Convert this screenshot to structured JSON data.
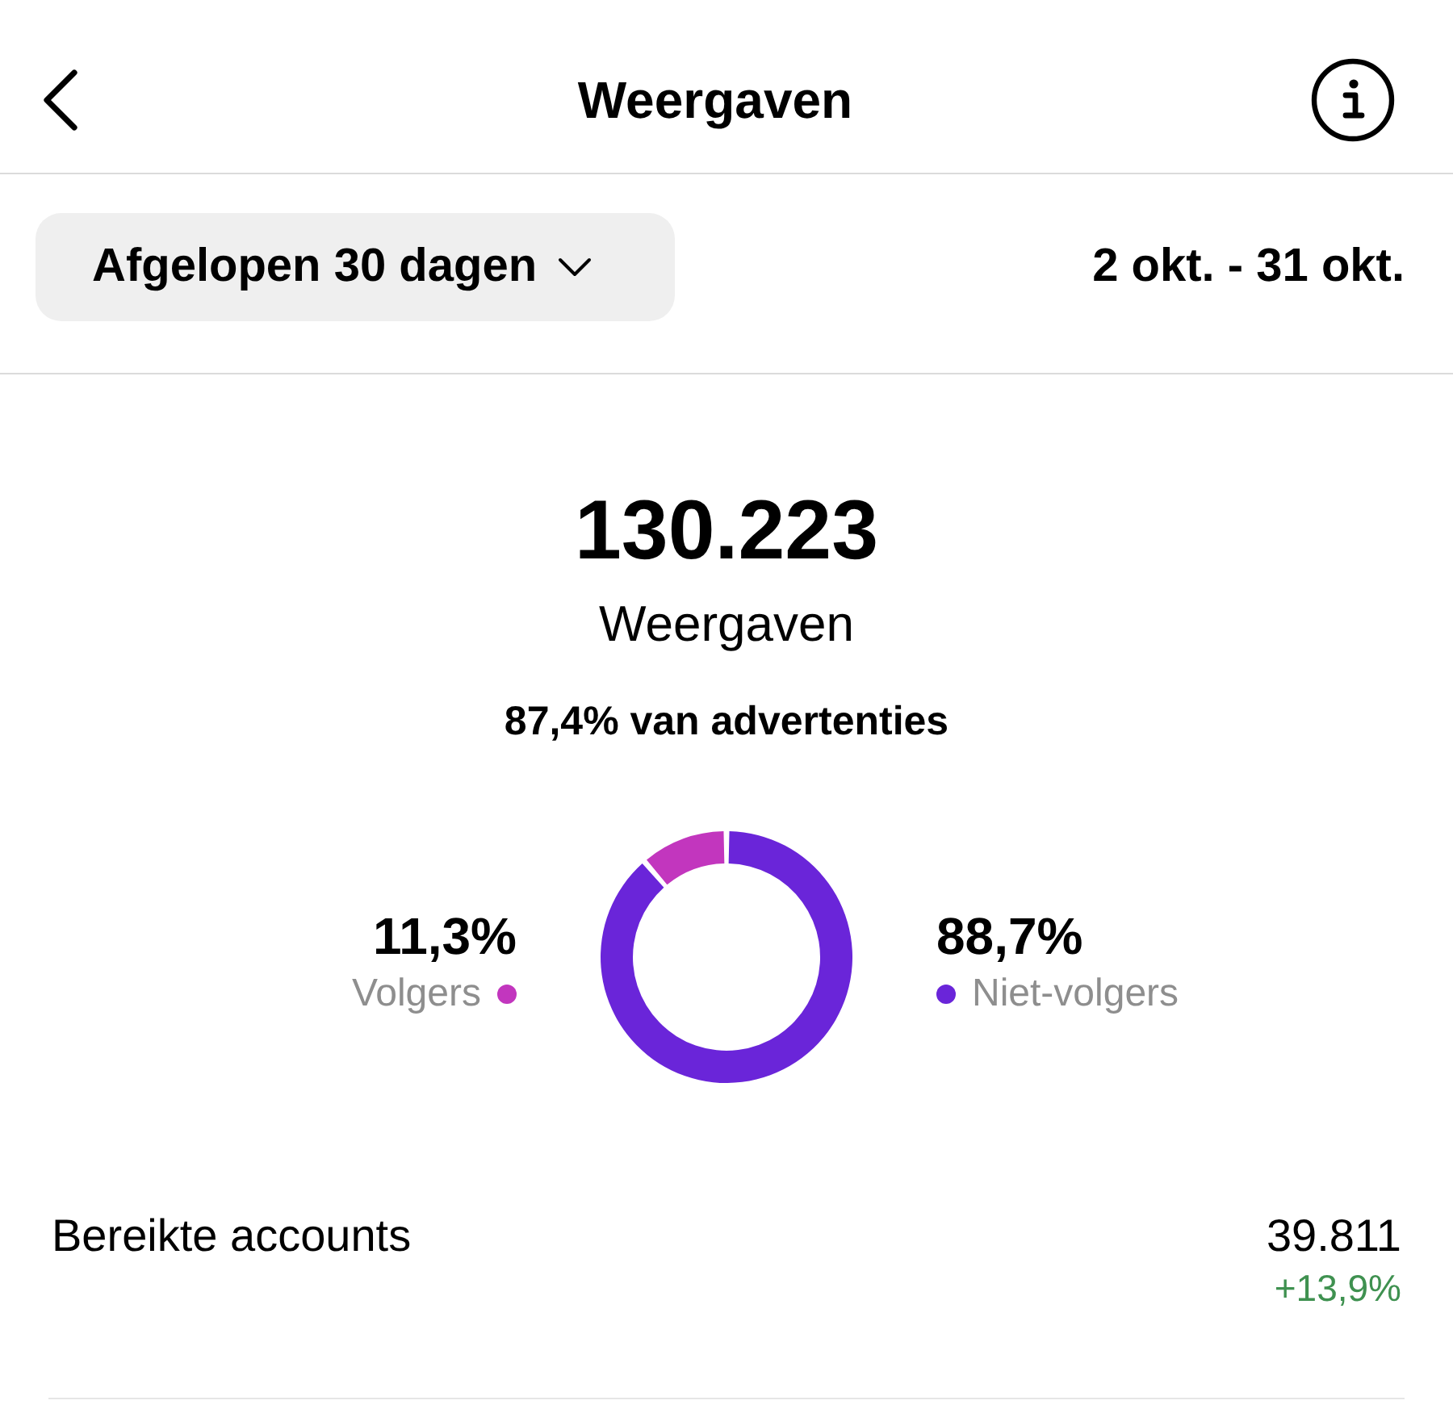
{
  "header": {
    "title": "Weergaven"
  },
  "filter": {
    "label": "Afgelopen 30 dagen",
    "date_range": "2 okt. - 31 okt."
  },
  "summary": {
    "total": "130.223",
    "label": "Weergaven",
    "ads_share": "87,4% van advertenties"
  },
  "breakdown": {
    "items": [
      {
        "value": "11,3%",
        "label": "Volgers",
        "color": "#c236be"
      },
      {
        "value": "88,7%",
        "label": "Niet-volgers",
        "color": "#6a25d9"
      }
    ],
    "chart_data": {
      "type": "donut",
      "values": [
        11.3,
        88.7
      ]
    }
  },
  "metrics": [
    {
      "label": "Bereikte accounts",
      "value": "39.811",
      "change": "+13,9%",
      "positive": true
    }
  ]
}
